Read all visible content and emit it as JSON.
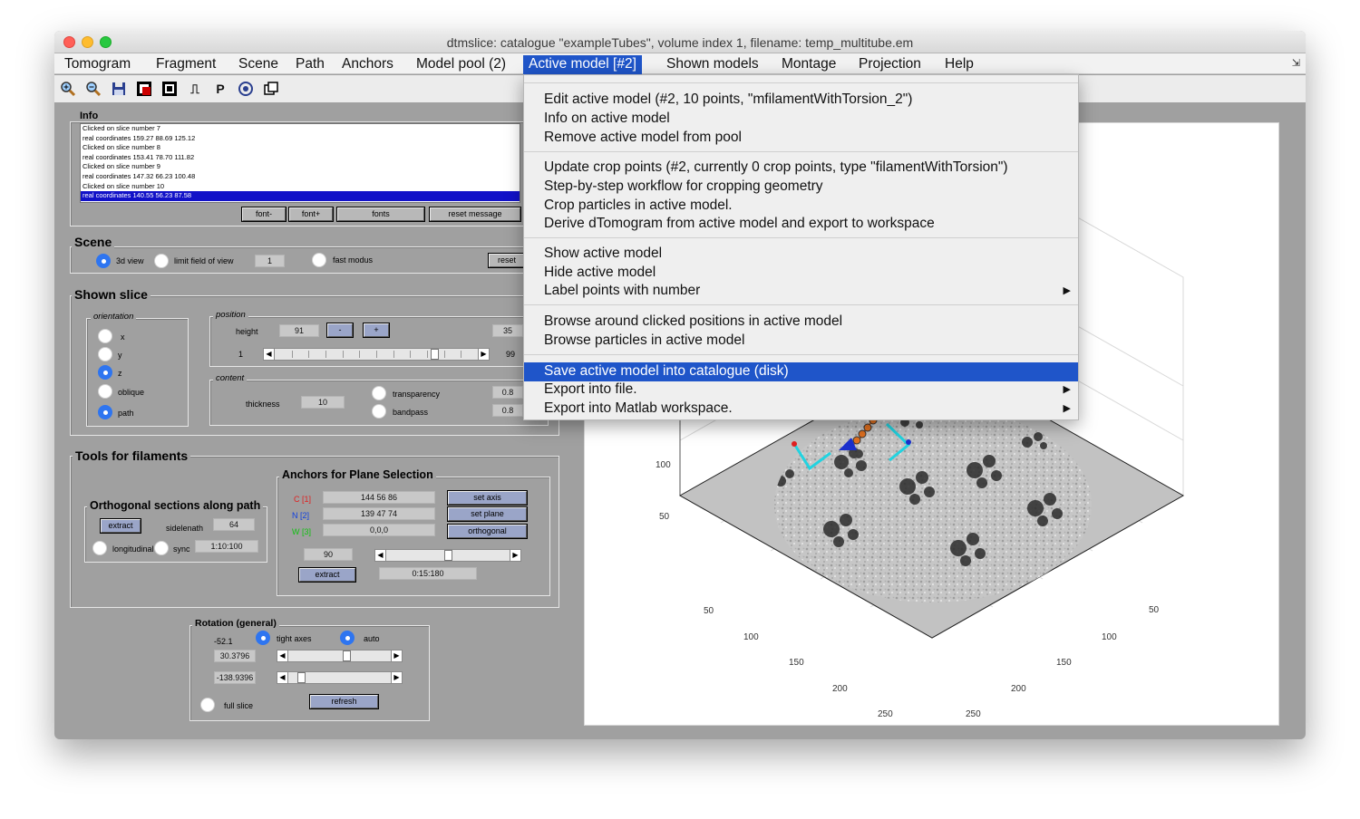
{
  "window": {
    "title": "dtmslice: catalogue \"exampleTubes\", volume index 1, filename: temp_multitube.em"
  },
  "menubar": {
    "items": [
      "Tomogram",
      "Fragment",
      "Scene",
      "Path",
      "Anchors",
      "Model pool (2)",
      "Active model [#2]",
      "Shown models",
      "Montage",
      "Projection",
      "Help"
    ],
    "corner": "⇲"
  },
  "toolbar": {
    "icons": [
      "zoom-in-icon",
      "zoom-out-icon",
      "save-icon",
      "dark-contrast-icon",
      "contrast-icon",
      "pulse-icon",
      "p-icon",
      "rotate-3d-icon",
      "window-copy-icon"
    ],
    "glyphs": {
      "p": "P",
      "pulse": "⎍"
    }
  },
  "info": {
    "label": "Info",
    "log": [
      "Clicked on slice number 7",
      "real coordinates 159.27 88.69 125.12",
      "Clicked on slice number 8",
      "real coordinates 153.41 78.70 111.82",
      "Clicked on slice number 9",
      "real coordinates 147.32 66.23 100.48",
      "Clicked on slice number 10",
      "real coordinates 140.55 56.23 87.58"
    ],
    "buttons": {
      "font_minus": "font-",
      "font_plus": "font+",
      "fonts": "fonts",
      "reset_message": "reset message"
    }
  },
  "scene": {
    "label": "Scene",
    "view3d": "3d view",
    "limit_fov": "limit field of view",
    "fov_value": "1",
    "fast_modus": "fast modus",
    "reset": "reset"
  },
  "shown_slice": {
    "label": "Shown slice",
    "orientation": {
      "label": "orientation",
      "options": [
        "x",
        "y",
        "z",
        "oblique",
        "path"
      ]
    },
    "position": {
      "label": "position",
      "height_label": "height",
      "height_value": "91",
      "minus": "-",
      "plus": "+",
      "max_value": "35",
      "slider_min": "1",
      "slider_max": "99",
      "slider_level": 0.8
    },
    "content": {
      "label": "content",
      "thickness_label": "thickness",
      "thickness_value": "10",
      "transparency": "transparency",
      "transparency_value": "0.8",
      "bandpass": "bandpass",
      "bandpass_value": "0.8"
    }
  },
  "tools": {
    "label": "Tools for filaments",
    "orthogonal": {
      "label": "Orthogonal sections along path",
      "extract": "extract",
      "sidelength_label": "sidelenath",
      "sidelength_value": "64",
      "longitudinal": "longitudinal",
      "sync": "sync",
      "range": "1:10:100"
    },
    "anchors": {
      "label": "Anchors for Plane Selection",
      "c_label": "C [1]",
      "c_value": "144 56 86",
      "c_color": "#e02020",
      "n_label": "N [2]",
      "n_value": "139 47 74",
      "n_color": "#1040e0",
      "w_label": "W [3]",
      "w_value": "0,0,0",
      "w_color": "#10c010",
      "set_axis": "set axis",
      "set_plane": "set plane",
      "orthogonal": "orthogonal",
      "angle_value": "90",
      "angle_level": 0.5,
      "extract": "extract",
      "range": "0:15:180"
    }
  },
  "rotation": {
    "label": "Rotation (general)",
    "value_top": "-52.1",
    "tight_axes": "tight axes",
    "auto": "auto",
    "elev_value": "30.3796",
    "elev_level": 0.58,
    "azim_value": "-138.9396",
    "azim_level": 0.1,
    "full_slice": "full slice",
    "refresh": "refresh"
  },
  "plot": {
    "z_ticks": [
      "100",
      "50"
    ],
    "x_ticks": [
      "50",
      "100",
      "150",
      "200",
      "250"
    ],
    "y_ticks": [
      "50",
      "100",
      "150",
      "200",
      "250"
    ]
  },
  "dropdown": {
    "groups": [
      [
        {
          "label": "Edit active model (#2, 10 points, \"mfilamentWithTorsion_2\")"
        },
        {
          "label": "Info on active model"
        },
        {
          "label": "Remove active model from pool"
        }
      ],
      [
        {
          "label": "Update crop points (#2, currently 0 crop points, type \"filamentWithTorsion\")"
        },
        {
          "label": "Step-by-step workflow for cropping geometry"
        },
        {
          "label": "Crop particles in active model."
        },
        {
          "label": "Derive dTomogram from active model and export to workspace"
        }
      ],
      [
        {
          "label": "Show active model"
        },
        {
          "label": "Hide active model"
        },
        {
          "label": "Label points with number",
          "submenu": true
        }
      ],
      [
        {
          "label": "Browse around clicked positions in active model"
        },
        {
          "label": "Browse particles in active model"
        }
      ],
      [
        {
          "label": "Save active model into catalogue (disk)",
          "highlighted": true
        },
        {
          "label": "Export into file.",
          "submenu": true
        },
        {
          "label": "Export into Matlab workspace.",
          "submenu": true
        }
      ]
    ],
    "submenu_glyph": "▶",
    "highlight_color": "#1f55c9"
  }
}
